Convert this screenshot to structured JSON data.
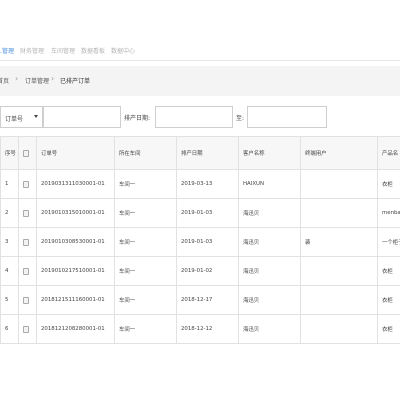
{
  "nav": {
    "items": [
      {
        "label": "…管理"
      },
      {
        "label": "财务管理"
      },
      {
        "label": "车间管理"
      },
      {
        "label": "数据看板"
      },
      {
        "label": "数据中心"
      }
    ]
  },
  "breadcrumb": {
    "home": "首页",
    "order_mgmt": "订单管理",
    "current": "已排产订单"
  },
  "filters": {
    "select_value": "订单号",
    "order_placeholder": "",
    "date_label": "排产日期:",
    "to_label": "至:"
  },
  "table": {
    "headers": {
      "seq": "序号",
      "order_no": "订单号",
      "workshop": "所在车间",
      "date": "排产日期",
      "customer": "客户名称",
      "end_user": "终端用户",
      "product": "产品名"
    },
    "rows": [
      {
        "seq": "1",
        "order_no": "2019031311030001-01",
        "workshop": "车间一",
        "date": "2019-03-13",
        "customer": "HAIXUN",
        "end_user": "",
        "product": "衣柜"
      },
      {
        "seq": "2",
        "order_no": "2019010315010001-01",
        "workshop": "车间一",
        "date": "2019-01-03",
        "customer": "海迅贝",
        "end_user": "",
        "product": "menban"
      },
      {
        "seq": "3",
        "order_no": "2019010308530001-01",
        "workshop": "车间一",
        "date": "2019-01-03",
        "customer": "海迅贝",
        "end_user": "裴",
        "product": "一个柜子"
      },
      {
        "seq": "4",
        "order_no": "2019010217510001-01",
        "workshop": "车间一",
        "date": "2019-01-02",
        "customer": "海迅贝",
        "end_user": "",
        "product": "衣柜"
      },
      {
        "seq": "5",
        "order_no": "2018121511160001-01",
        "workshop": "车间一",
        "date": "2018-12-17",
        "customer": "海迅贝",
        "end_user": "",
        "product": "衣柜"
      },
      {
        "seq": "6",
        "order_no": "2018121208280001-01",
        "workshop": "车间一",
        "date": "2018-12-12",
        "customer": "海迅贝",
        "end_user": "",
        "product": "衣柜"
      }
    ]
  }
}
